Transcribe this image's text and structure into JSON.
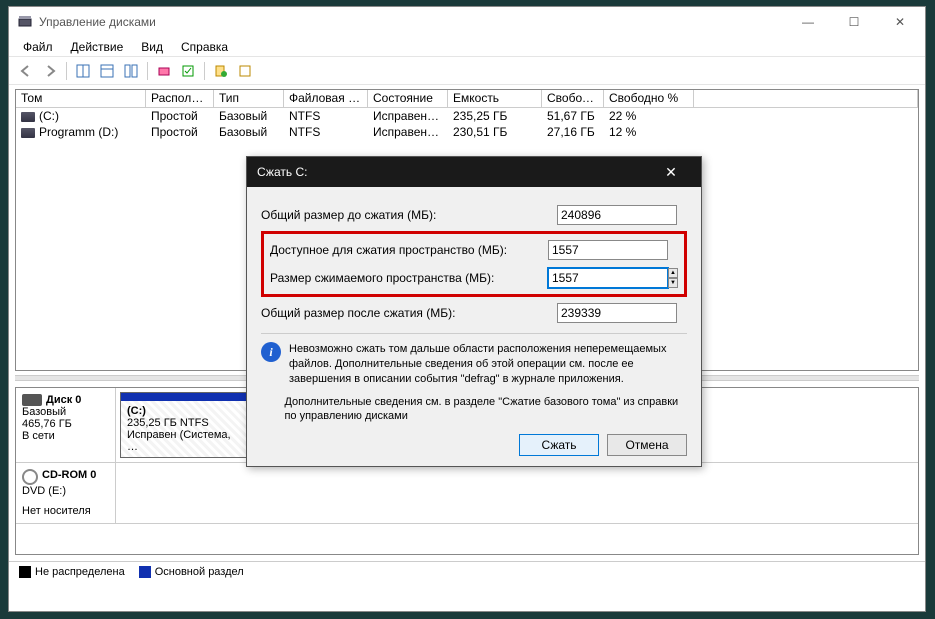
{
  "window": {
    "title": "Управление дисками",
    "min": "—",
    "max": "☐",
    "close": "✕"
  },
  "menu": {
    "file": "Файл",
    "action": "Действие",
    "view": "Вид",
    "help": "Справка"
  },
  "columns": {
    "tom": "Том",
    "layout": "Располо…",
    "type": "Тип",
    "fs": "Файловая с…",
    "state": "Состояние",
    "capacity": "Емкость",
    "free": "Свобод…",
    "freepct": "Свободно %"
  },
  "volumes": [
    {
      "name": "(C:)",
      "layout": "Простой",
      "type": "Базовый",
      "fs": "NTFS",
      "state": "Исправен…",
      "capacity": "235,25 ГБ",
      "free": "51,67 ГБ",
      "freepct": "22 %"
    },
    {
      "name": "Programm (D:)",
      "layout": "Простой",
      "type": "Базовый",
      "fs": "NTFS",
      "state": "Исправен…",
      "capacity": "230,51 ГБ",
      "free": "27,16 ГБ",
      "freepct": "12 %"
    }
  ],
  "disk0": {
    "header": "Диск 0",
    "type": "Базовый",
    "size": "465,76 ГБ",
    "status": "В сети",
    "part": {
      "name": "(C:)",
      "desc": "235,25 ГБ NTFS",
      "state": "Исправен (Система, …"
    }
  },
  "cd": {
    "header": "CD-ROM 0",
    "name": "DVD (E:)",
    "status": "Нет носителя"
  },
  "legend": {
    "unalloc": "Не распределена",
    "primary": "Основной раздел"
  },
  "dialog": {
    "title": "Сжать C:",
    "row_total_before": "Общий размер до сжатия (МБ):",
    "val_total_before": "240896",
    "row_avail": "Доступное для сжатия пространство (МБ):",
    "val_avail": "1557",
    "row_shrink": "Размер сжимаемого пространства (МБ):",
    "val_shrink": "1557",
    "row_total_after": "Общий размер после сжатия (МБ):",
    "val_total_after": "239339",
    "info1": "Невозможно сжать том дальше области расположения неперемещаемых файлов. Дополнительные сведения об этой операции см. после ее завершения в описании события \"defrag\" в журнале приложения.",
    "info2": "Дополнительные сведения см. в разделе \"Сжатие базового тома\" из справки по управлению дисками",
    "btn_shrink": "Сжать",
    "btn_cancel": "Отмена"
  }
}
